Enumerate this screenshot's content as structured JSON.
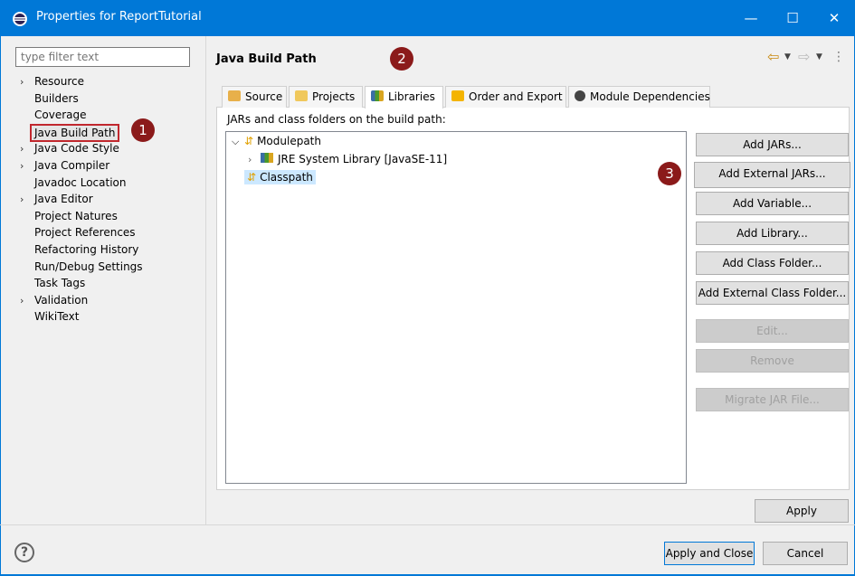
{
  "window": {
    "title": "Properties for ReportTutorial",
    "minimize_glyph": "—",
    "maximize_glyph": "☐",
    "close_glyph": "✕"
  },
  "filter": {
    "placeholder": "type filter text"
  },
  "tree": [
    {
      "label": "Resource",
      "expandable": true
    },
    {
      "label": "Builders",
      "expandable": false
    },
    {
      "label": "Coverage",
      "expandable": false
    },
    {
      "label": "Java Build Path",
      "expandable": false,
      "selected": true
    },
    {
      "label": "Java Code Style",
      "expandable": true
    },
    {
      "label": "Java Compiler",
      "expandable": true
    },
    {
      "label": "Javadoc Location",
      "expandable": false
    },
    {
      "label": "Java Editor",
      "expandable": true
    },
    {
      "label": "Project Natures",
      "expandable": false
    },
    {
      "label": "Project References",
      "expandable": false
    },
    {
      "label": "Refactoring History",
      "expandable": false
    },
    {
      "label": "Run/Debug Settings",
      "expandable": false
    },
    {
      "label": "Task Tags",
      "expandable": false
    },
    {
      "label": "Validation",
      "expandable": true
    },
    {
      "label": "WikiText",
      "expandable": false
    }
  ],
  "page": {
    "title": "Java Build Path"
  },
  "tabs": [
    {
      "label": "Source",
      "icon": "source-icon"
    },
    {
      "label": "Projects",
      "icon": "projects-icon"
    },
    {
      "label": "Libraries",
      "icon": "libraries-icon",
      "active": true
    },
    {
      "label": "Order and Export",
      "icon": "order-export-icon"
    },
    {
      "label": "Module Dependencies",
      "icon": "module-dependencies-icon"
    }
  ],
  "build_path": {
    "label": "JARs and class folders on the build path:",
    "nodes": [
      {
        "label": "Modulepath",
        "icon": "modulepath-icon",
        "expanded": true
      },
      {
        "label": "JRE System Library [JavaSE-11]",
        "icon": "library-icon"
      },
      {
        "label": "Classpath",
        "icon": "classpath-icon",
        "selected": true
      }
    ]
  },
  "buttons": {
    "add_jars": "Add JARs...",
    "add_external_jars": "Add External JARs...",
    "add_variable": "Add Variable...",
    "add_library": "Add Library...",
    "add_class_folder": "Add Class Folder...",
    "add_external_class_folder": "Add External Class Folder...",
    "edit": "Edit...",
    "remove": "Remove",
    "migrate": "Migrate JAR File...",
    "apply": "Apply",
    "apply_and_close": "Apply and Close",
    "cancel": "Cancel"
  },
  "help": {
    "glyph": "?"
  },
  "annotations": [
    "1",
    "2",
    "3"
  ],
  "colors": {
    "titlebar": "#0078d7",
    "annotation": "#8b1a1a",
    "highlight": "#c1272d"
  }
}
